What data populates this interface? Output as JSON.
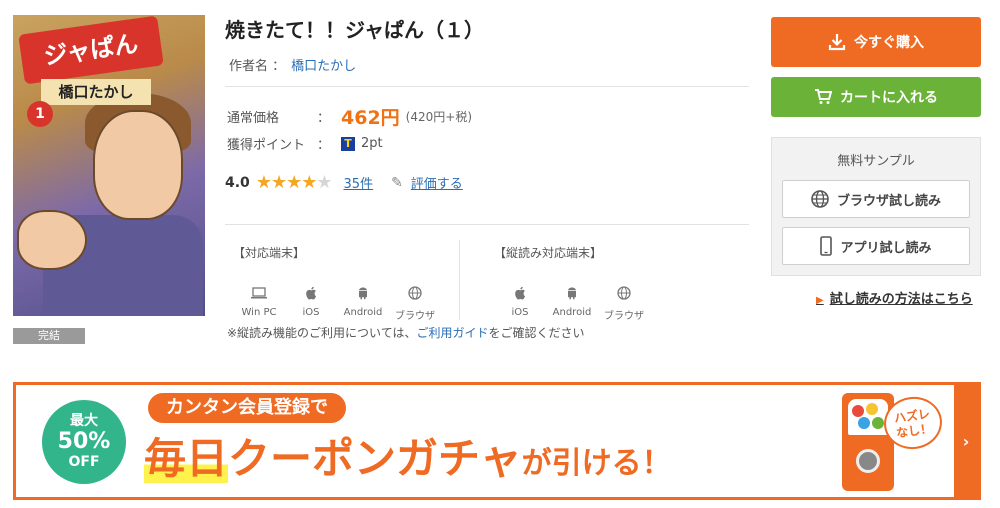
{
  "book": {
    "cover_alt": "焼きたて!!ジャぱん",
    "cover_title": "ジャぱん",
    "cover_author": "橋口たかし",
    "cover_volume": "1",
    "status_badge": "完結"
  },
  "product": {
    "title": "焼きたて！！ジャぱん（１）",
    "author_label": "作者名 ：",
    "author_name": "橋口たかし",
    "price_label": "通常価格",
    "price_colon": "：",
    "price": "462円",
    "price_tax": "(420円+税)",
    "point_label": "獲得ポイント",
    "point_colon": "：",
    "point_value": "2pt",
    "rating": "4.0",
    "stars_filled": 4,
    "stars_total": 5,
    "review_count": "35件",
    "rate_link": "評価する"
  },
  "devices": {
    "supported_title": "【対応端末】",
    "supported": [
      {
        "icon": "pc-icon",
        "label": "Win PC"
      },
      {
        "icon": "apple-icon",
        "label": "iOS"
      },
      {
        "icon": "android-icon",
        "label": "Android"
      },
      {
        "icon": "browser-icon",
        "label": "ブラウザ"
      }
    ],
    "vertical_title": "【縦読み対応端末】",
    "vertical": [
      {
        "icon": "apple-icon",
        "label": "iOS"
      },
      {
        "icon": "android-icon",
        "label": "Android"
      },
      {
        "icon": "browser-icon",
        "label": "ブラウザ"
      }
    ],
    "note_prefix": "※縦読み機能のご利用については、",
    "note_link": "ご利用ガイド",
    "note_suffix": "をご確認ください"
  },
  "actions": {
    "buy_label": "今すぐ購入",
    "cart_label": "カートに入れる",
    "sample_title": "無料サンプル",
    "browser_sample": "ブラウザ試し読み",
    "app_sample": "アプリ試し読み",
    "how_to_link": "試し読みの方法はこちら"
  },
  "banner": {
    "circle_line1": "最大",
    "circle_line2": "50%",
    "circle_line3": "OFF",
    "pill_text": "カンタン会員登録で",
    "main_highlight": "毎日",
    "main_text": "クーポンガチャ",
    "main_small": "が引ける！",
    "bubble_line1": "ハズレ",
    "bubble_line2": "なし！",
    "arrow": "›"
  },
  "colors": {
    "accent_orange": "#ef6a22",
    "cart_green": "#6bb239",
    "price_orange": "#f07214",
    "link_blue": "#2a6db5",
    "star_gold": "#f5a623",
    "banner_green": "#33b58c"
  }
}
